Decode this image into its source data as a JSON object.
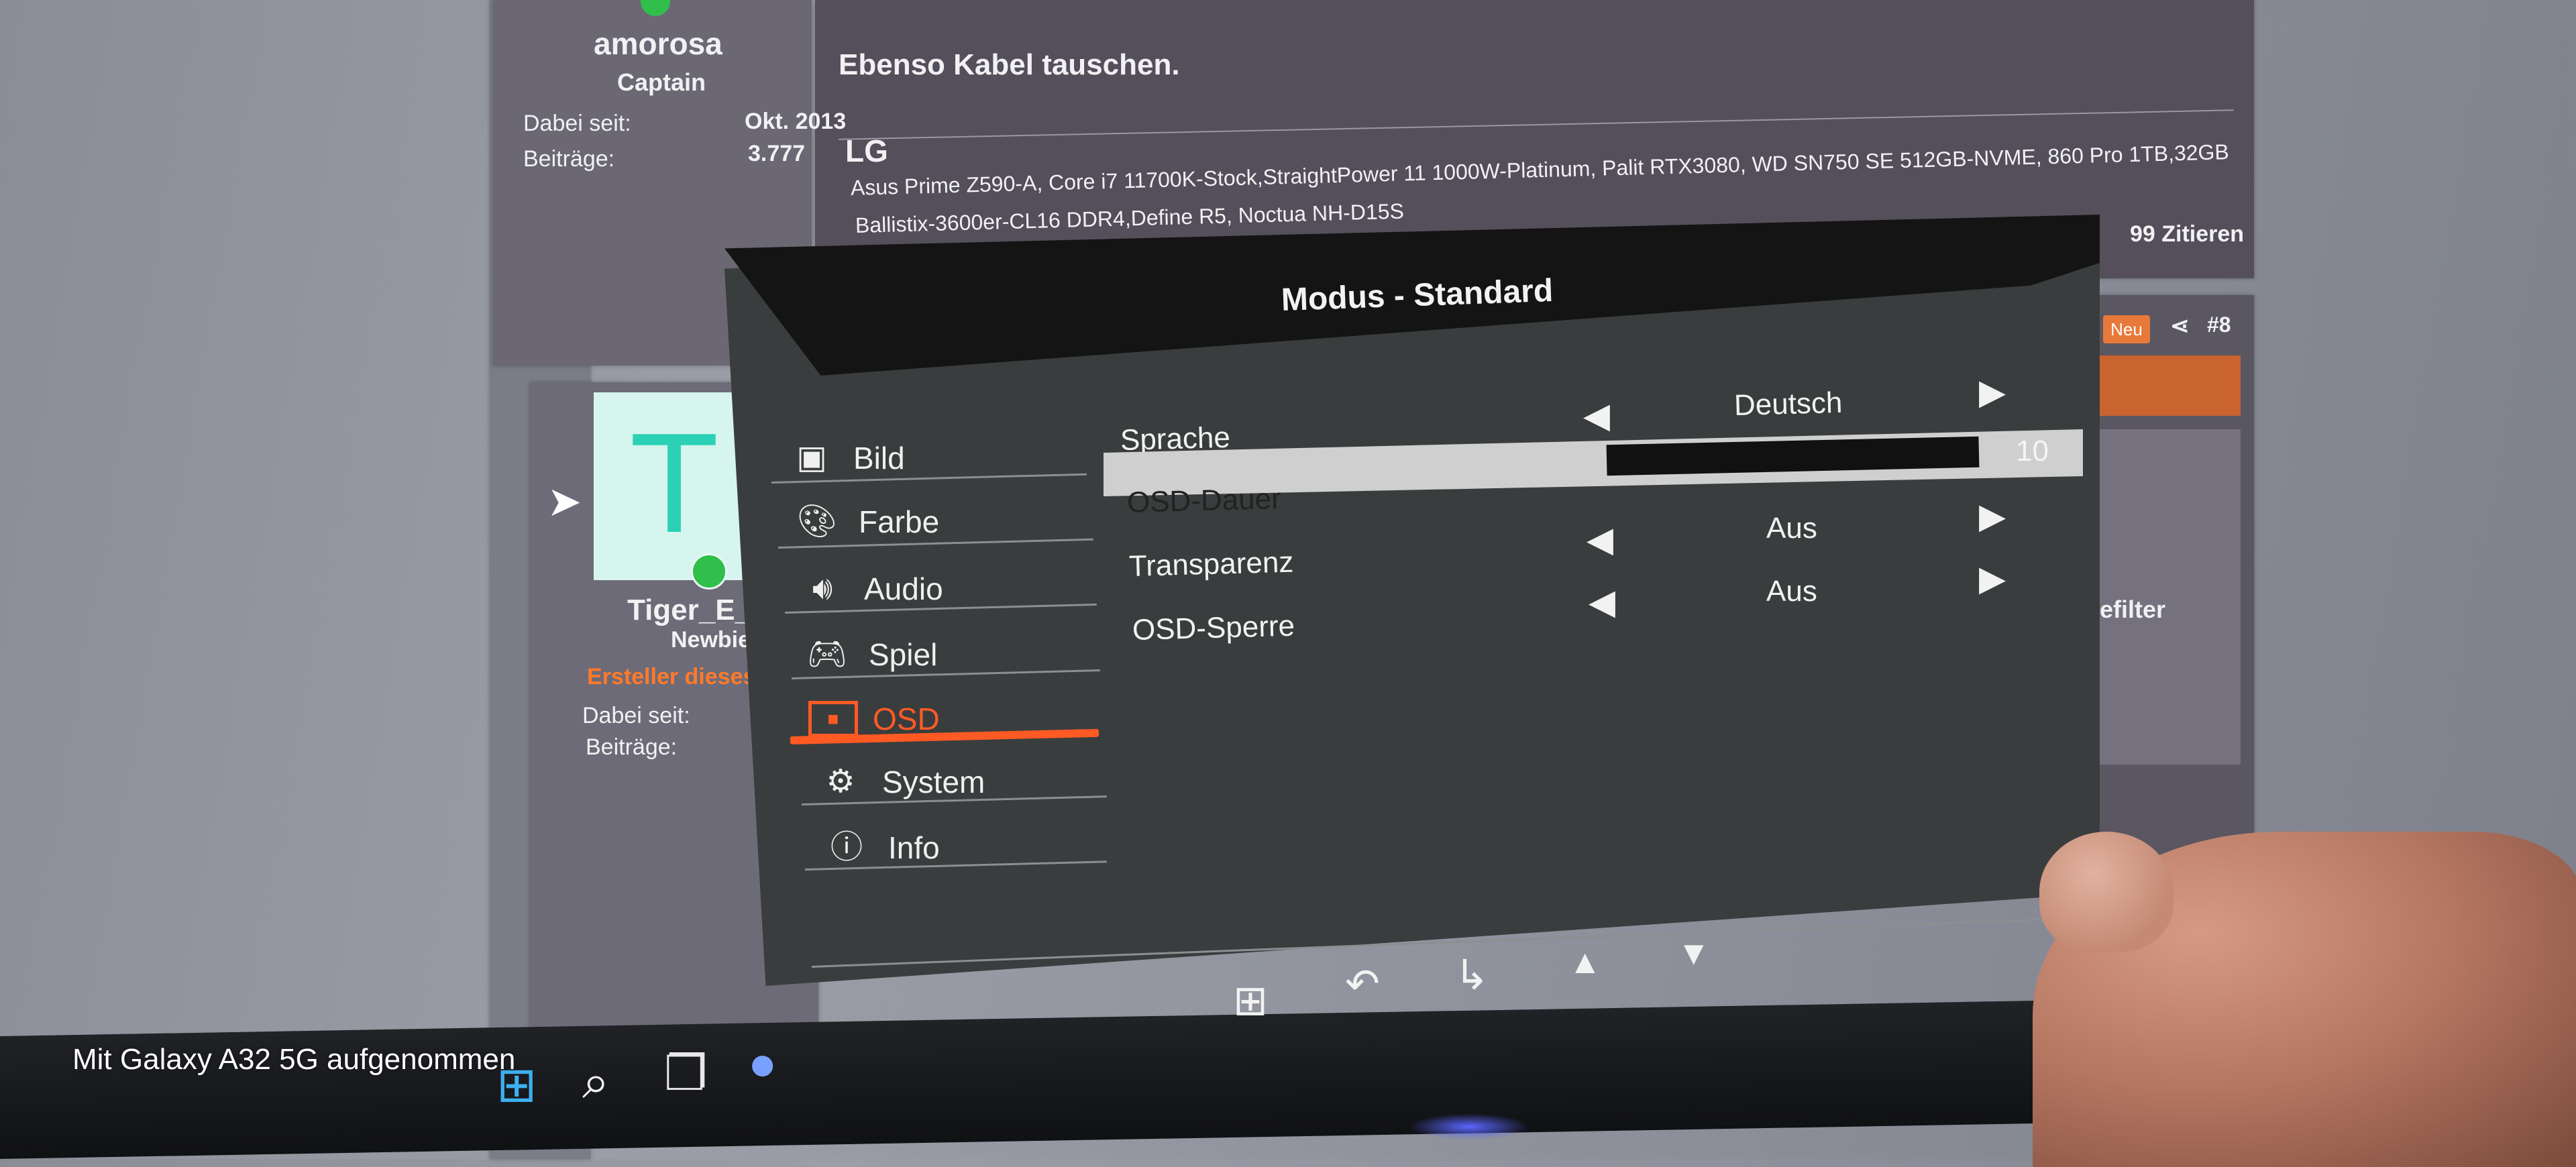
{
  "forum": {
    "post1": {
      "username": "amorosa",
      "rank": "Captain",
      "since_label": "Dabei seit:",
      "since_value": "Okt. 2013",
      "posts_label": "Beiträge:",
      "posts_value": "3.777",
      "message_line1": "Ebenso Kabel tauschen.",
      "message_line2": "LG",
      "signature_line1": "Asus Prime Z590-A, Core i7 11700K-Stock,StraightPower 11 1000W-Platinum, Palit RTX3080, WD SN750 SE 512GB-NVME, 860 Pro 1TB,32GB",
      "signature_line2": "Ballistix-3600er-CL16 DDR4,Define R5, Noctua NH-D15S",
      "quote_button": "99 Zitieren"
    },
    "post2": {
      "avatar_letter": "T",
      "username": "Tiger_E_1",
      "rank": "Newbie",
      "creator_label": "Ersteller dieses",
      "since_label": "Dabei seit:",
      "posts_label": "Beiträge:",
      "new_badge": "Neu",
      "post_number": "#8",
      "sidebar_text": "efilter"
    }
  },
  "osd": {
    "title": "Modus  -  Standard",
    "nav": [
      {
        "label": "Bild",
        "icon": "image-icon"
      },
      {
        "label": "Farbe",
        "icon": "palette-icon"
      },
      {
        "label": "Audio",
        "icon": "speaker-icon"
      },
      {
        "label": "Spiel",
        "icon": "gamepad-icon"
      },
      {
        "label": "OSD",
        "icon": "osd-icon",
        "active": true
      },
      {
        "label": "System",
        "icon": "gear-icon"
      },
      {
        "label": "Info",
        "icon": "info-icon"
      }
    ],
    "rows": {
      "sprache": {
        "label": "Sprache",
        "value": "Deutsch"
      },
      "osd_dauer": {
        "label": "OSD-Dauer",
        "value": "10"
      },
      "transparenz": {
        "label": "Transparenz",
        "value": "Aus"
      },
      "osd_sperre": {
        "label": "OSD-Sperre",
        "value": "Aus"
      }
    },
    "accent_color": "#ff5a24"
  },
  "watermark": "Mit Galaxy A32 5G aufgenommen"
}
